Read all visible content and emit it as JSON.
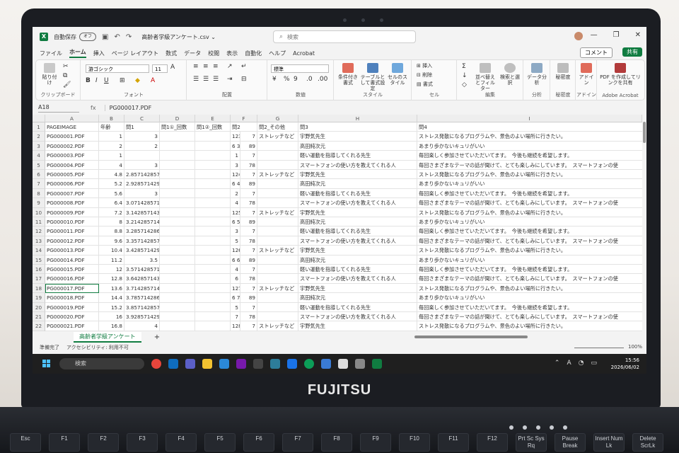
{
  "window": {
    "autosave_label": "自動保存",
    "autosave_state": "オフ",
    "filename": "高齢者学級アンケート.csv ⌄",
    "search_placeholder": "検索"
  },
  "menu": {
    "tabs": [
      "ファイル",
      "ホーム",
      "挿入",
      "ページ レイアウト",
      "数式",
      "データ",
      "校閲",
      "表示",
      "自動化",
      "ヘルプ",
      "Acrobat"
    ],
    "comment_label": "コメント",
    "share_label": "共有"
  },
  "ribbon": {
    "clipboard": "クリップボード",
    "paste": "貼り付け",
    "font_group": "フォント",
    "font_name": "游ゴシック",
    "font_size": "11",
    "align_group": "配置",
    "number_group": "数値",
    "number_format": "標準",
    "style_group": "スタイル",
    "cond_format": "条件付き書式",
    "table_format": "テーブルとして書式設定",
    "cell_style": "セルのスタイル",
    "cells_group": "セル",
    "insert": "挿入",
    "delete": "削除",
    "format": "書式",
    "edit_group": "編集",
    "sort_filter": "並べ替えとフィルター",
    "find_select": "検索と選択",
    "analysis_group": "分析",
    "data_analysis": "データ分析",
    "sensitivity_group": "秘密度",
    "sensitivity": "秘密度",
    "addin_group": "アドイン",
    "addin": "アドイン",
    "acrobat_group": "Adobe Acrobat",
    "pdf_share": "PDF を作成してリンクを共有"
  },
  "formula_bar": {
    "name_box": "A18",
    "fx": "fx",
    "formula": "PG000017.PDF"
  },
  "grid": {
    "columns": [
      "A",
      "B",
      "C",
      "D",
      "E",
      "F",
      "G",
      "H",
      "I"
    ],
    "header_row": [
      "PAGEIMAGE",
      "年齢",
      "問1",
      "問1①_回数",
      "問1②_回数",
      "問2",
      "問2_その他",
      "問3",
      "問4"
    ],
    "rows": [
      [
        "PG000001.PDF",
        "1",
        "3",
        "",
        "",
        "123",
        "7",
        "ストレッチなど",
        "宇野気先生",
        "ストレス発散になるプログラムや、景色のよい場所に行きたい。"
      ],
      [
        "PG000002.PDF",
        "2",
        "2",
        "",
        "",
        "6 3",
        "89",
        "",
        "高田純次元",
        "あまり歩かないキュリがいい"
      ],
      [
        "PG000003.PDF",
        "1",
        "",
        "",
        "",
        "1",
        "7",
        "",
        "軽い運動を指導してくれる先生",
        "毎回楽しく参加させていただいてます。　今後も継続を希望します。"
      ],
      [
        "PG000004.PDF",
        "4",
        "3",
        "",
        "",
        "3",
        "78",
        "",
        "スマートフォンの使い方を教えてくれる人",
        "毎回さまざまなテーマの話が聞けて、とても楽しみにしています。　スマートフォンの使"
      ],
      [
        "PG000005.PDF",
        "4.8",
        "2.857142857",
        "",
        "",
        "124",
        "7",
        "ストレッチなど",
        "宇野気先生",
        "ストレス発散になるプログラムや、景色のよい場所に行きたい。"
      ],
      [
        "PG000006.PDF",
        "5.2",
        "2.928571429",
        "",
        "",
        "6 4",
        "89",
        "",
        "高田純次元",
        "あまり歩かないキュリがいい"
      ],
      [
        "PG000007.PDF",
        "5.6",
        "3",
        "",
        "",
        "2",
        "7",
        "",
        "軽い運動を指導してくれる先生",
        "毎回楽しく参加させていただいてます。　今後も継続を希望します。"
      ],
      [
        "PG000008.PDF",
        "6.4",
        "3.071428571",
        "",
        "",
        "4",
        "78",
        "",
        "スマートフォンの使い方を教えてくれる人",
        "毎回さまざまなテーマの話が聞けて、とても楽しみにしています。　スマートフォンの使"
      ],
      [
        "PG000009.PDF",
        "7.2",
        "3.142857143",
        "",
        "",
        "125",
        "7",
        "ストレッチなど",
        "宇野気先生",
        "ストレス発散になるプログラムや、景色のよい場所に行きたい。"
      ],
      [
        "PG000010.PDF",
        "8",
        "3.214285714",
        "",
        "",
        "6 5",
        "89",
        "",
        "高田純次元",
        "あまり歩かないキュリがいい"
      ],
      [
        "PG000011.PDF",
        "8.8",
        "3.285714286",
        "",
        "",
        "3",
        "7",
        "",
        "軽い運動を指導してくれる先生",
        "毎回楽しく参加させていただいてます。　今後も継続を希望します。"
      ],
      [
        "PG000012.PDF",
        "9.6",
        "3.357142857",
        "",
        "",
        "5",
        "78",
        "",
        "スマートフォンの使い方を教えてくれる人",
        "毎回さまざまなテーマの話が聞けて、とても楽しみにしています。　スマートフォンの使"
      ],
      [
        "PG000013.PDF",
        "10.4",
        "3.428571429",
        "",
        "",
        "126",
        "7",
        "ストレッチなど",
        "宇野気先生",
        "ストレス発散になるプログラムや、景色のよい場所に行きたい。"
      ],
      [
        "PG000014.PDF",
        "11.2",
        "3.5",
        "",
        "",
        "6 6",
        "89",
        "",
        "高田純次元",
        "あまり歩かないキュリがいい"
      ],
      [
        "PG000015.PDF",
        "12",
        "3.571428571",
        "",
        "",
        "4",
        "7",
        "",
        "軽い運動を指導してくれる先生",
        "毎回楽しく参加させていただいてます。　今後も継続を希望します。"
      ],
      [
        "PG000016.PDF",
        "12.8",
        "3.642857143",
        "",
        "",
        "6",
        "78",
        "",
        "スマートフォンの使い方を教えてくれる人",
        "毎回さまざまなテーマの話が聞けて、とても楽しみにしています。　スマートフォンの使"
      ],
      [
        "PG000017.PDF",
        "13.6",
        "3.714285714",
        "",
        "",
        "127",
        "7",
        "ストレッチなど",
        "宇野気先生",
        "ストレス発散になるプログラムや、景色のよい場所に行きたい。"
      ],
      [
        "PG000018.PDF",
        "14.4",
        "3.785714286",
        "",
        "",
        "6 7",
        "89",
        "",
        "高田純次元",
        "あまり歩かないキュリがいい"
      ],
      [
        "PG000019.PDF",
        "15.2",
        "3.857142857",
        "",
        "",
        "5",
        "7",
        "",
        "軽い運動を指導してくれる先生",
        "毎回楽しく参加させていただいてます。　今後も継続を希望します。"
      ],
      [
        "PG000020.PDF",
        "16",
        "3.928571429",
        "",
        "",
        "7",
        "78",
        "",
        "スマートフォンの使い方を教えてくれる人",
        "毎回さまざまなテーマの話が聞けて、とても楽しみにしています。　スマートフォンの使"
      ],
      [
        "PG000021.PDF",
        "16.8",
        "4",
        "",
        "",
        "128",
        "7",
        "ストレッチなど",
        "宇野気先生",
        "ストレス発散になるプログラムや、景色のよい場所に行きたい。"
      ]
    ]
  },
  "sheet": {
    "tab_name": "高齢者学級アンケート",
    "add": "+"
  },
  "status": {
    "ready": "準備完了",
    "accessibility": "アクセシビリティ: 利用不可",
    "zoom": "100%"
  },
  "taskbar": {
    "search": "検索",
    "time": "15:56",
    "date": "2026/06/02"
  },
  "device": {
    "brand": "FUJITSU",
    "keys": [
      "Esc",
      "F1",
      "F2",
      "F3",
      "F4",
      "F5",
      "F6",
      "F7",
      "F8",
      "F9",
      "F10",
      "F11",
      "F12",
      "Prt Sc Sys Rq",
      "Pause Break",
      "Insert Num Lk",
      "Delete ScrLk"
    ]
  }
}
